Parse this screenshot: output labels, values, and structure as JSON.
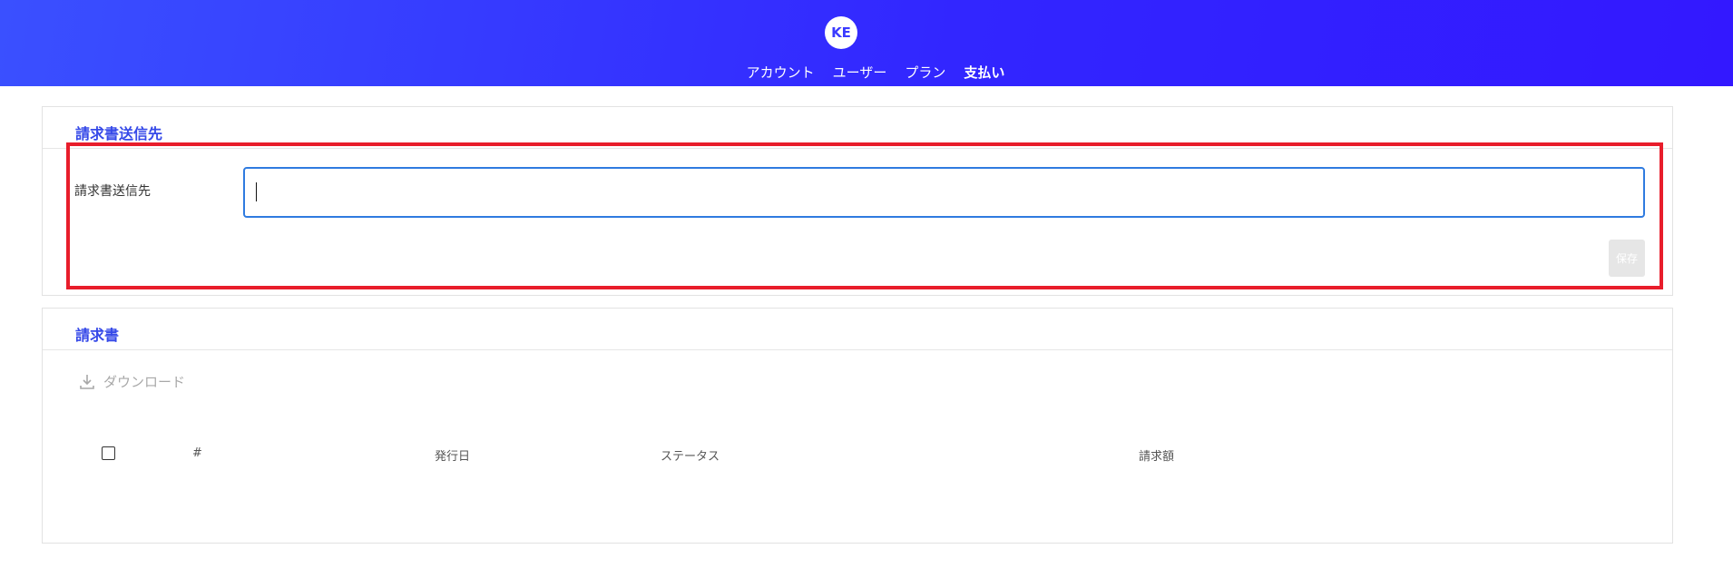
{
  "header": {
    "avatar_initials": "KE",
    "nav": [
      {
        "label": "アカウント",
        "active": false
      },
      {
        "label": "ユーザー",
        "active": false
      },
      {
        "label": "プラン",
        "active": false
      },
      {
        "label": "支払い",
        "active": true
      }
    ]
  },
  "billing": {
    "section_title": "請求書送信先",
    "field_label": "請求書送信先",
    "input_value": "",
    "save_label": "保存"
  },
  "invoices": {
    "section_title": "請求書",
    "download_label": "ダウンロード",
    "columns": [
      "#",
      "発行日",
      "ステータス",
      "請求額"
    ]
  },
  "colors": {
    "header_gradient_start": "#3a50ff",
    "header_gradient_end": "#3318ff",
    "accent_title": "#3549e8",
    "input_focus_border": "#2f7be0",
    "highlight_red": "#e81d2b"
  },
  "icons": {
    "download": "download-icon"
  }
}
